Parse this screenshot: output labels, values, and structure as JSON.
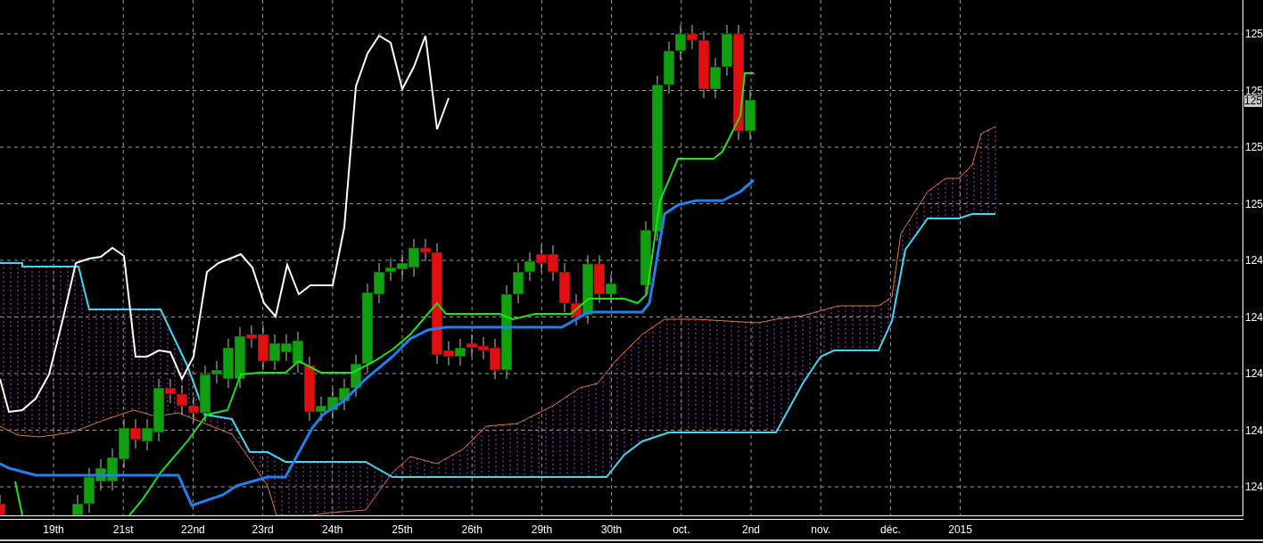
{
  "y_axis": {
    "labels": [
      "125",
      "125",
      "125",
      "125",
      "124",
      "124",
      "124",
      "124",
      "124"
    ],
    "current_price": "125"
  },
  "x_axis": {
    "labels": [
      "19th",
      "21st",
      "22nd",
      "23rd",
      "24th",
      "25th",
      "26th",
      "29th",
      "30th",
      "oct.",
      "2nd",
      "nov.",
      "déc.",
      "2015"
    ]
  }
}
